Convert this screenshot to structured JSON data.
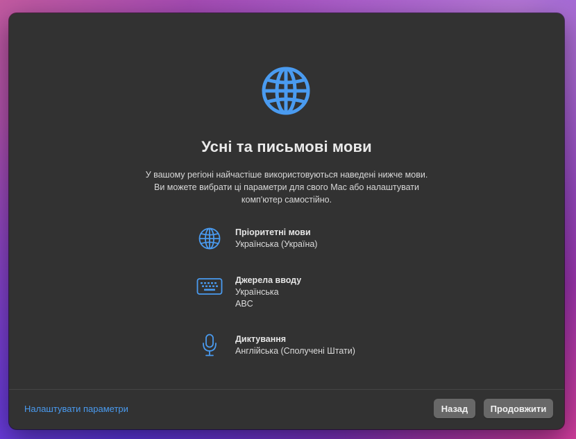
{
  "screen": {
    "title": "Усні та письмові мови",
    "description": "У вашому регіоні найчастіше використовуються наведені нижче мови. Ви можете вибрати ці параметри для свого Mac або налаштувати комп'ютер самостійно."
  },
  "items": [
    {
      "icon": "globe-icon",
      "heading": "Пріоритетні мови",
      "values": [
        "Українська (Україна)"
      ]
    },
    {
      "icon": "keyboard-icon",
      "heading": "Джерела вводу",
      "values": [
        "Українська",
        "ABC"
      ]
    },
    {
      "icon": "microphone-icon",
      "heading": "Диктування",
      "values": [
        "Англійська (Сполучені Штати)"
      ]
    }
  ],
  "footer": {
    "customize_link": "Налаштувати параметри",
    "back_label": "Назад",
    "continue_label": "Продовжити"
  },
  "colors": {
    "accent": "#4a9bf0",
    "window_bg": "#323232",
    "button_bg": "#686868"
  }
}
